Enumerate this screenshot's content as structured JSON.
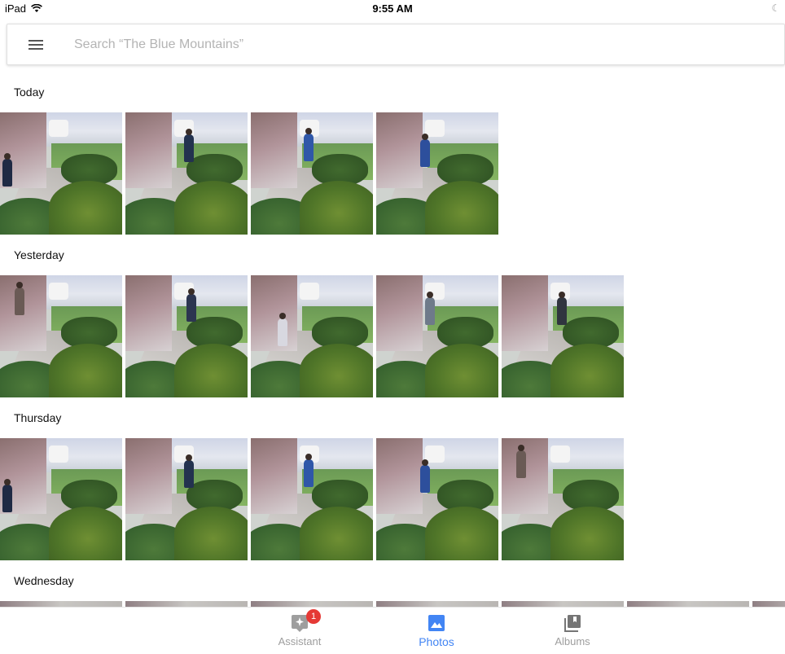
{
  "status_bar": {
    "device": "iPad",
    "time": "9:55 AM"
  },
  "search": {
    "placeholder": "Search “The Blue Mountains”"
  },
  "sections": [
    {
      "title": "Today",
      "photo_count": 4
    },
    {
      "title": "Yesterday",
      "photo_count": 5
    },
    {
      "title": "Thursday",
      "photo_count": 5
    },
    {
      "title": "Wednesday",
      "photo_count": 7
    }
  ],
  "bottom_nav": {
    "items": [
      {
        "label": "Assistant",
        "icon": "assistant-icon",
        "badge": "1",
        "active": false
      },
      {
        "label": "Photos",
        "icon": "photos-icon",
        "active": true
      },
      {
        "label": "Albums",
        "icon": "albums-icon",
        "active": false
      }
    ]
  },
  "colors": {
    "accent": "#4285f4",
    "inactive": "#9e9e9e",
    "badge": "#e53935"
  }
}
